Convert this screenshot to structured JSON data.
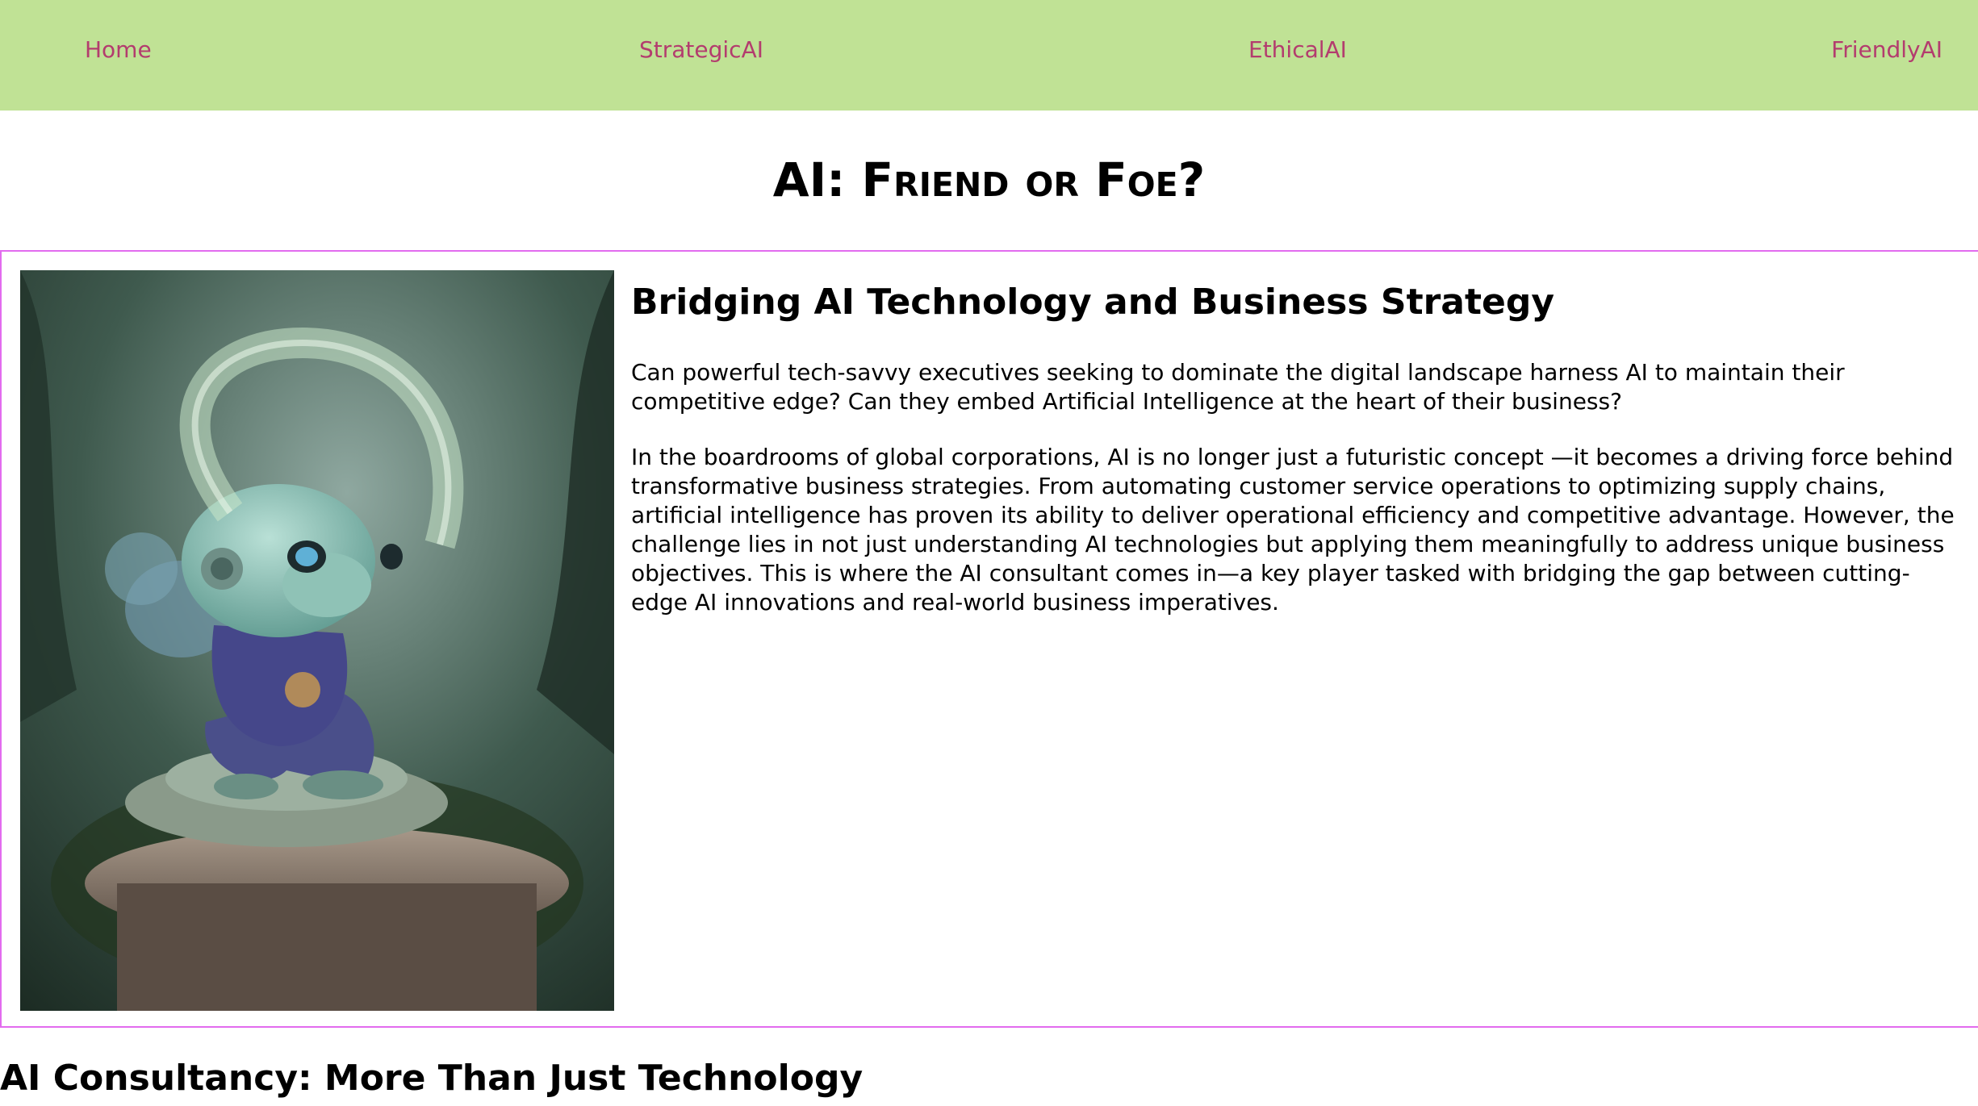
{
  "nav": {
    "home": "Home",
    "strategic": "StrategicAI",
    "ethical": "EthicalAI",
    "friendly": "FriendlyAI"
  },
  "site_title": "AI: Friend or Foe?",
  "feature": {
    "image_icon": "alien-creature-illustration",
    "heading": "Bridging AI Technology and Business Strategy",
    "question": "Can powerful tech-savvy executives seeking to dominate the digital landscape harness AI to maintain their competitive edge? Can they embed Artificial Intelligence at the heart of their business?",
    "body": "In the boardrooms of global corporations, AI is no longer just a futuristic concept —it becomes a driving force behind transformative business strategies. From automating customer service operations to optimizing supply chains, artificial intelligence has proven its ability to deliver operational efficiency and competitive advantage. However, the challenge lies in not just understanding AI technologies but applying them meaningfully to address unique business objectives. This is where the AI consultant comes in—a key player tasked with bridging the gap between cutting-edge AI innovations and real-world business imperatives."
  },
  "section2": {
    "heading": "AI Consultancy: More Than Just Technology"
  },
  "colors": {
    "nav_bg": "#c0e295",
    "nav_link": "#b33c6e",
    "section_border": "#e26bef"
  }
}
